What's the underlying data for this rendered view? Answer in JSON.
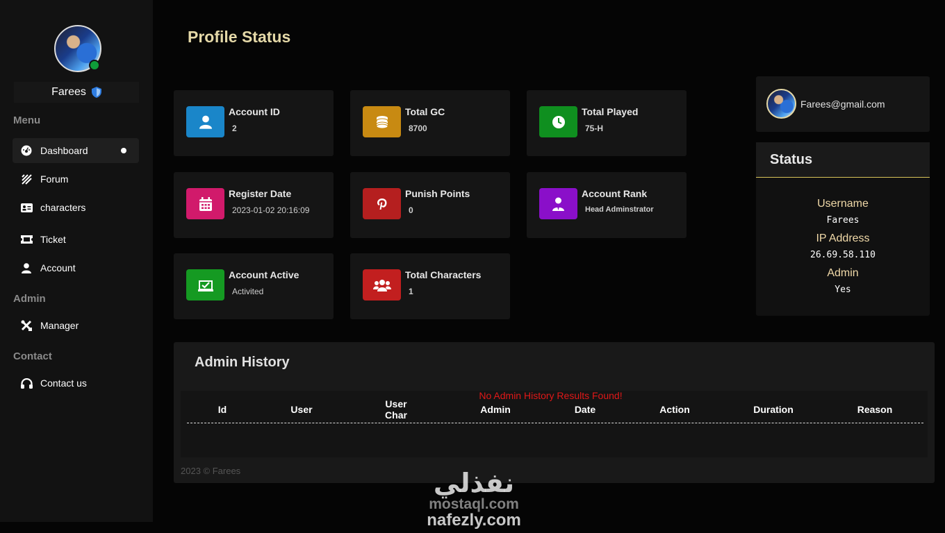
{
  "sidebar": {
    "username": "Farees",
    "menu_label": "Menu",
    "admin_label": "Admin",
    "contact_label": "Contact",
    "items": [
      {
        "label": "Dashboard"
      },
      {
        "label": "Forum"
      },
      {
        "label": "characters"
      },
      {
        "label": "Ticket"
      },
      {
        "label": "Account"
      },
      {
        "label": "Manager"
      },
      {
        "label": "Contact us"
      }
    ]
  },
  "page": {
    "title": "Profile Status"
  },
  "cards": [
    {
      "title": "Account ID",
      "value": "2",
      "color": "#1a86c9",
      "icon": "user-icon"
    },
    {
      "title": "Total GC",
      "value": "8700",
      "color": "#c88a12",
      "icon": "coins-icon"
    },
    {
      "title": "Total Played",
      "value": "75-H",
      "color": "#0f8f1f",
      "icon": "clock-icon"
    },
    {
      "title": "Register Date",
      "value": "2023-01-02 20:16:09",
      "color": "#d11a6b",
      "icon": "calendar-icon"
    },
    {
      "title": "Punish Points",
      "value": "0",
      "color": "#b51f1f",
      "icon": "pinterest-icon"
    },
    {
      "title": "Account Rank",
      "value": "Head Adminstrator",
      "color": "#8a0fc9",
      "icon": "user-tie-icon"
    },
    {
      "title": "Account Active",
      "value": "Activited",
      "color": "#159a22",
      "icon": "check-box-icon"
    },
    {
      "title": "Total Characters",
      "value": "1",
      "color": "#c21f1f",
      "icon": "users-icon"
    }
  ],
  "profile": {
    "email": "Farees@gmail.com"
  },
  "status": {
    "title": "Status",
    "username_label": "Username",
    "username": "Farees",
    "ip_label": "IP Address",
    "ip": "26.69.58.110",
    "admin_label": "Admin",
    "admin": "Yes"
  },
  "history": {
    "title": "Admin History",
    "columns": [
      "Id",
      "User",
      "User Char",
      "Admin",
      "Date",
      "Action",
      "Duration",
      "Reason"
    ],
    "empty_message": "No Admin History Results Found!",
    "footer": "2023 © Farees"
  },
  "watermark": {
    "arabic": "نفذلي",
    "line1": "mostaql.com",
    "line2": "nafezly.com"
  },
  "colors": {
    "accent_gold": "#e5d9a8",
    "online": "#0f9d3a",
    "error": "#e01818"
  }
}
